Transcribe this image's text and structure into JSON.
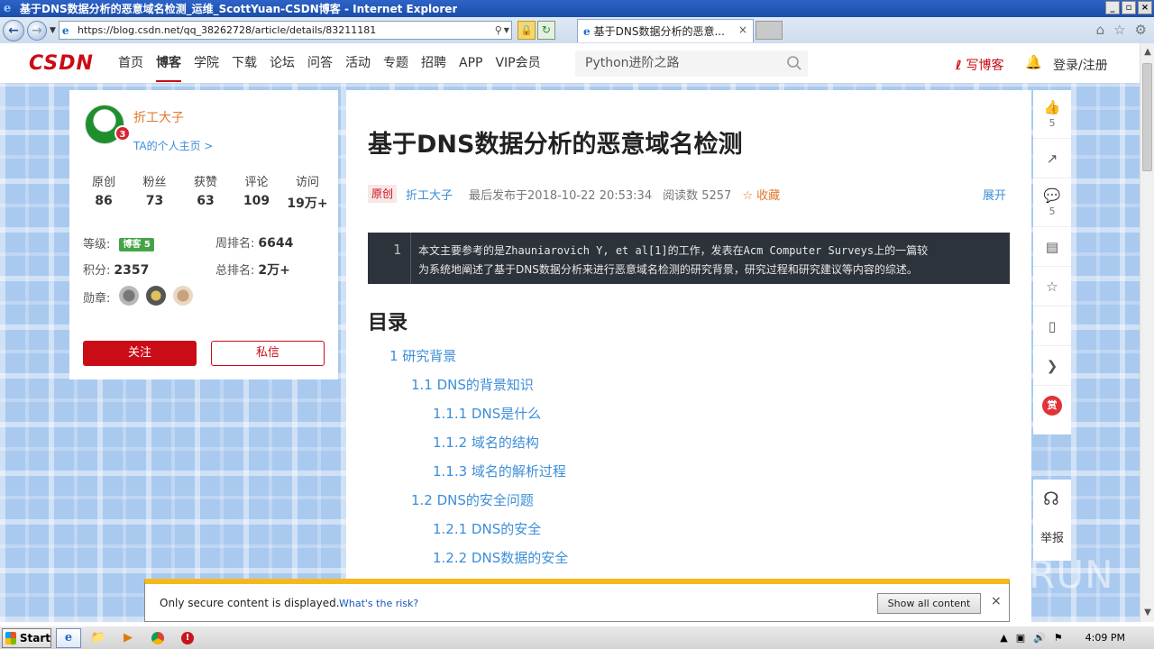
{
  "window": {
    "title": "基于DNS数据分析的恶意域名检测_运维_ScottYuan-CSDN博客 - Internet Explorer",
    "controls": [
      "_",
      "▫",
      "×"
    ]
  },
  "browser": {
    "url": "https://blog.csdn.net/qq_38262728/article/details/83211181",
    "tab_title": "基于DNS数据分析的恶意...",
    "tab_close": "×"
  },
  "csdn": {
    "logo": "CSDN",
    "nav": [
      "首页",
      "博客",
      "学院",
      "下载",
      "论坛",
      "问答",
      "活动",
      "专题",
      "招聘",
      "APP",
      "VIP会员"
    ],
    "active_nav": "博客",
    "search_text": "Python进阶之路",
    "write_blog": "写博客",
    "login": "登录/注册",
    "brand_color": "#ca0c16"
  },
  "profile": {
    "name": "折工大子",
    "home_link": "TA的个人主页 >",
    "avatar_badge": "3",
    "stats": [
      {
        "label": "原创",
        "value": "86"
      },
      {
        "label": "粉丝",
        "value": "73"
      },
      {
        "label": "获赞",
        "value": "63"
      },
      {
        "label": "评论",
        "value": "109"
      },
      {
        "label": "访问",
        "value": "19万+"
      }
    ],
    "level_label": "等级:",
    "level_badge": "博客 5",
    "week_rank_label": "周排名:",
    "week_rank": "6644",
    "points_label": "积分:",
    "points": "2357",
    "total_rank_label": "总排名:",
    "total_rank": "2万+",
    "medals_label": "勋章:",
    "follow": "关注",
    "message": "私信"
  },
  "article": {
    "title": "基于DNS数据分析的恶意域名检测",
    "tag": "原创",
    "author": "折工大子",
    "published": "最后发布于2018-10-22 20:53:34",
    "reads": "阅读数 5257",
    "favorite": "☆ 收藏",
    "expand": "展开",
    "code_line_no": "1",
    "code_line_1": "本文主要参考的是Zhauniarovich Y, et al[1]的工作，发表在Acm Computer Surveys上的一篇较",
    "code_line_2": "为系统地阐述了基于DNS数据分析来进行恶意域名检测的研究背景，研究过程和研究建议等内容的综述。",
    "toc_heading": "目录",
    "toc": [
      "1 研究背景",
      "1.1 DNS的背景知识",
      "1.1.1 DNS是什么",
      "1.1.2 域名的结构",
      "1.1.3 域名的解析过程",
      "1.2 DNS的安全问题",
      "1.2.1 DNS的安全",
      "1.2.2 DNS数据的安全"
    ]
  },
  "toolbar": {
    "like_count": "5",
    "comment_count": "5",
    "reward": "赏",
    "report": "举报"
  },
  "watermark": "ANY RUN",
  "notification": {
    "message": "Only secure content is displayed.",
    "link": "What's the risk?",
    "button": "Show all content",
    "close": "×"
  },
  "taskbar": {
    "start": "Start",
    "time": "4:09 PM"
  }
}
